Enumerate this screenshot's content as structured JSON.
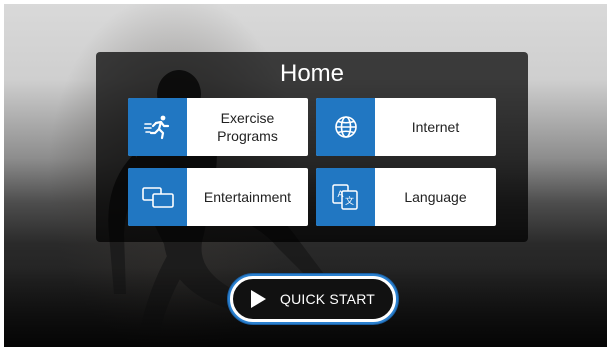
{
  "home": {
    "title": "Home"
  },
  "tiles": [
    {
      "icon": "runner-icon",
      "label_line1": "Exercise",
      "label_line2": "Programs"
    },
    {
      "icon": "globe-icon",
      "label": "Internet"
    },
    {
      "icon": "screens-icon",
      "label": "Entertainment"
    },
    {
      "icon": "translate-icon",
      "label": "Language",
      "icon_text_a": "A",
      "icon_text_b": "文"
    }
  ],
  "quick_start": {
    "label": "QUICK START"
  },
  "colors": {
    "accent": "#2177c2",
    "panel": "#000000",
    "tile_bg": "#ffffff"
  }
}
